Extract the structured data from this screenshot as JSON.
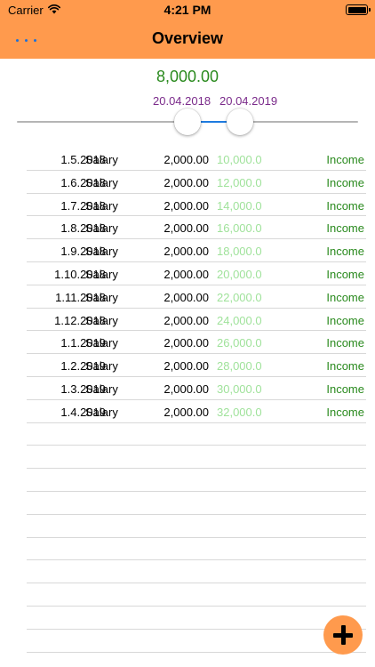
{
  "status_bar": {
    "carrier": "Carrier",
    "time": "4:21 PM"
  },
  "nav": {
    "title": "Overview",
    "menu_icon": "more-dots-icon"
  },
  "summary": {
    "total": "8,000.00",
    "date_from": "20.04.2018",
    "date_to": "20.04.2019"
  },
  "transactions": [
    {
      "date": "1.5.2018",
      "description": "Salary",
      "amount": "2,000.00",
      "balance": "10,000.0",
      "type": "Income"
    },
    {
      "date": "1.6.2018",
      "description": "Salary",
      "amount": "2,000.00",
      "balance": "12,000.0",
      "type": "Income"
    },
    {
      "date": "1.7.2018",
      "description": "Salary",
      "amount": "2,000.00",
      "balance": "14,000.0",
      "type": "Income"
    },
    {
      "date": "1.8.2018",
      "description": "Salary",
      "amount": "2,000.00",
      "balance": "16,000.0",
      "type": "Income"
    },
    {
      "date": "1.9.2018",
      "description": "Salary",
      "amount": "2,000.00",
      "balance": "18,000.0",
      "type": "Income"
    },
    {
      "date": "1.10.2018",
      "description": "Salary",
      "amount": "2,000.00",
      "balance": "20,000.0",
      "type": "Income"
    },
    {
      "date": "1.11.2018",
      "description": "Salary",
      "amount": "2,000.00",
      "balance": "22,000.0",
      "type": "Income"
    },
    {
      "date": "1.12.2018",
      "description": "Salary",
      "amount": "2,000.00",
      "balance": "24,000.0",
      "type": "Income"
    },
    {
      "date": "1.1.2019",
      "description": "Salary",
      "amount": "2,000.00",
      "balance": "26,000.0",
      "type": "Income"
    },
    {
      "date": "1.2.2019",
      "description": "Salary",
      "amount": "2,000.00",
      "balance": "28,000.0",
      "type": "Income"
    },
    {
      "date": "1.3.2019",
      "description": "Salary",
      "amount": "2,000.00",
      "balance": "30,000.0",
      "type": "Income"
    },
    {
      "date": "1.4.2019",
      "description": "Salary",
      "amount": "2,000.00",
      "balance": "32,000.0",
      "type": "Income"
    }
  ],
  "colors": {
    "header": "#ff9a4d",
    "total_text": "#2a8a1e",
    "date_text": "#7a2a8a",
    "balance_text": "#9fe29a",
    "type_text": "#2a8a1e",
    "slider_active": "#1e7be0"
  },
  "fab": {
    "icon": "plus-icon"
  }
}
